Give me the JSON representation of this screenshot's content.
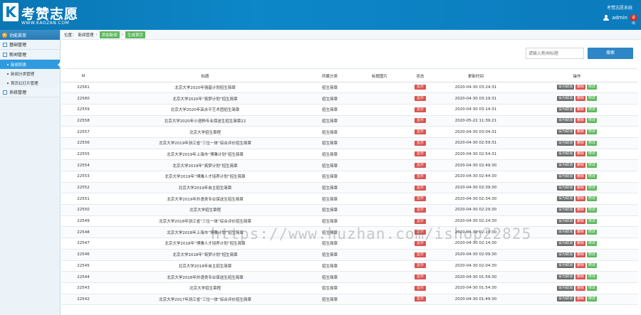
{
  "header": {
    "logo_letter": "K",
    "logo_text": "考赞志愿",
    "logo_url": "WWW.KAOZAN.COM",
    "system_name": "考赞志愿系统",
    "user_name": "admin",
    "exit_label": "退出"
  },
  "sidebar": {
    "head": "功能菜单",
    "groups": [
      {
        "label": "基础管理"
      },
      {
        "label": "新闻管理"
      }
    ],
    "subitems": [
      {
        "label": "新闻列表"
      },
      {
        "label": "新闻分类管理"
      },
      {
        "label": "首页幻灯片管理"
      }
    ],
    "group_last": "系统管理"
  },
  "breadcrumb": {
    "prefix": "位置：",
    "item1": "新闻管理",
    "item2": "添加新闻",
    "item3": "生成首页"
  },
  "search": {
    "placeholder": "请输入新闻标题",
    "button_label": "搜索"
  },
  "table": {
    "headers": [
      "Id",
      "标题",
      "所属分类",
      "标题图片",
      "状态",
      "更新时间",
      "操作"
    ],
    "status_label": "显示",
    "op_top": "设为取消",
    "op_del": "删除",
    "op_edit": "修改",
    "rows": [
      {
        "id": "22561",
        "title": "北京大学2020年强基计划招生简章",
        "cat": "招生简章",
        "time": "2020-04-30 03:24:31"
      },
      {
        "id": "22560",
        "title": "北京大学2020年“筑梦计划”招生简章",
        "cat": "招生简章",
        "time": "2020-04-30 03:19:31"
      },
      {
        "id": "22559",
        "title": "北京大学2020年高水平艺术团招生简章",
        "cat": "招生简章",
        "time": "2020-04-30 03:14:31"
      },
      {
        "id": "22558",
        "title": "北京大学2020年小语种专业保送生招生简章22",
        "cat": "招生简章",
        "time": "2020-05-22 11:39:21"
      },
      {
        "id": "22557",
        "title": "北京大学招生章程",
        "cat": "招生简章",
        "time": "2020-04-30 03:04:31"
      },
      {
        "id": "22556",
        "title": "北京大学2019年浙江省“三位一体”综合评价招生简章",
        "cat": "招生简章",
        "time": "2020-04-30 02:59:31"
      },
      {
        "id": "22555",
        "title": "北京大学2019年上海市“博雅计划”招生简章",
        "cat": "招生简章",
        "time": "2020-04-30 02:54:31"
      },
      {
        "id": "22554",
        "title": "北京大学2019年“筑梦计划”招生简章",
        "cat": "招生简章",
        "time": "2020-04-30 02:49:30"
      },
      {
        "id": "22553",
        "title": "北京大学2019年“博雅人才培养计划”招生简章",
        "cat": "招生简章",
        "time": "2020-04-30 02:44:30"
      },
      {
        "id": "22552",
        "title": "北京大学2019年自主招生简章",
        "cat": "招生简章",
        "time": "2020-04-30 02:39:30"
      },
      {
        "id": "22551",
        "title": "北京大学2019年外语类专业保送生招生简章",
        "cat": "招生简章",
        "time": "2020-04-30 02:34:30"
      },
      {
        "id": "22550",
        "title": "北京大学招生章程",
        "cat": "招生简章",
        "time": "2020-04-30 02:29:30"
      },
      {
        "id": "22549",
        "title": "北京大学2018年浙江省“三位一体”综合评价招生简章",
        "cat": "招生简章",
        "time": "2020-04-30 02:24:30"
      },
      {
        "id": "22548",
        "title": "北京大学2018年上海市“博雅计划”招生简章",
        "cat": "招生简章",
        "time": "2020-04-30 02:19:30"
      },
      {
        "id": "22547",
        "title": "北京大学2018年“博雅人才培养计划”招生简章",
        "cat": "招生简章",
        "time": "2020-04-30 02:14:30"
      },
      {
        "id": "22546",
        "title": "北京大学2018年“筑梦计划”招生简章",
        "cat": "招生简章",
        "time": "2020-04-30 02:09:30"
      },
      {
        "id": "22545",
        "title": "北京大学2018年自主招生简章",
        "cat": "招生简章",
        "time": "2020-04-30 02:04:30"
      },
      {
        "id": "22544",
        "title": "北京大学2018年外语类专业保送生招生简章",
        "cat": "招生简章",
        "time": "2020-04-30 01:59:30"
      },
      {
        "id": "22543",
        "title": "北京大学招生章程",
        "cat": "招生简章",
        "time": "2020-04-30 01:54:30"
      },
      {
        "id": "22542",
        "title": "北京大学2017年浙江省“三位一体”综合评价招生简章",
        "cat": "招生简章",
        "time": "2020-04-30 01:49:30"
      }
    ]
  },
  "watermark": "https://www.huzhan.com/ishop22825",
  "colors": {
    "header_blue": "#0b7bbd",
    "status_red": "#d9534f",
    "edit_green": "#5cb85c",
    "top_gray": "#6d6d6d"
  }
}
